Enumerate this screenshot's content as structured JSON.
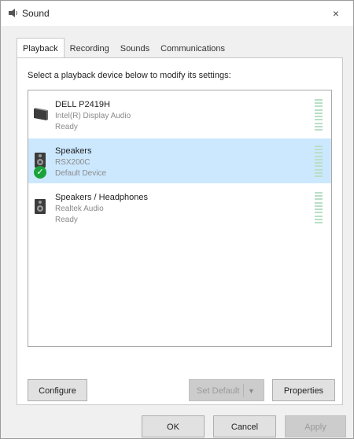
{
  "window": {
    "title": "Sound",
    "close_glyph": "×"
  },
  "tabs": [
    {
      "label": "Playback",
      "active": true
    },
    {
      "label": "Recording",
      "active": false
    },
    {
      "label": "Sounds",
      "active": false
    },
    {
      "label": "Communications",
      "active": false
    }
  ],
  "instruction": "Select a playback device below to modify its settings:",
  "devices": [
    {
      "name": "DELL P2419H",
      "description": "Intel(R) Display Audio",
      "status": "Ready",
      "icon": "monitor-icon",
      "selected": false,
      "default": false
    },
    {
      "name": "Speakers",
      "description": "RSX200C",
      "status": "Default Device",
      "icon": "speaker-icon",
      "selected": true,
      "default": true
    },
    {
      "name": "Speakers / Headphones",
      "description": "Realtek Audio",
      "status": "Ready",
      "icon": "speaker-icon",
      "selected": false,
      "default": false
    }
  ],
  "buttons": {
    "configure": "Configure",
    "set_default": "Set Default",
    "properties": "Properties",
    "ok": "OK",
    "cancel": "Cancel",
    "apply": "Apply"
  },
  "colors": {
    "selection": "#cce8ff",
    "default_check": "#1aa33b",
    "meter": "#b8dfc6"
  }
}
